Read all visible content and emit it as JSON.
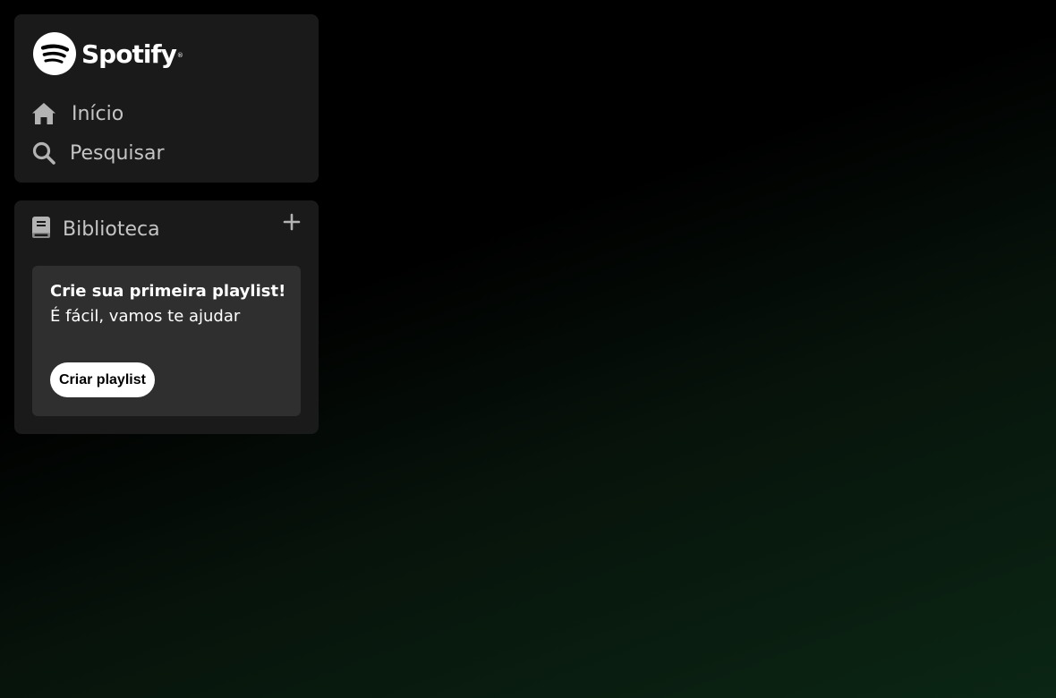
{
  "brand": {
    "name": "Spotify",
    "registered_mark": "®",
    "icon": "spotify-logo"
  },
  "nav": {
    "items": [
      {
        "label": "Início",
        "icon": "home-icon"
      },
      {
        "label": "Pesquisar",
        "icon": "search-icon"
      }
    ]
  },
  "library": {
    "label": "Biblioteca",
    "icon": "library-icon",
    "add_icon": "plus-icon",
    "card": {
      "title": "Crie sua primeira playlist!",
      "subtitle": "É fácil, vamos te ajudar",
      "button_label": "Criar playlist"
    }
  },
  "colors": {
    "panel": "#1a1a1a",
    "card": "#2f2f2f",
    "text_muted": "#b3b3b3",
    "accent_gradient_end": "#0b2614"
  }
}
